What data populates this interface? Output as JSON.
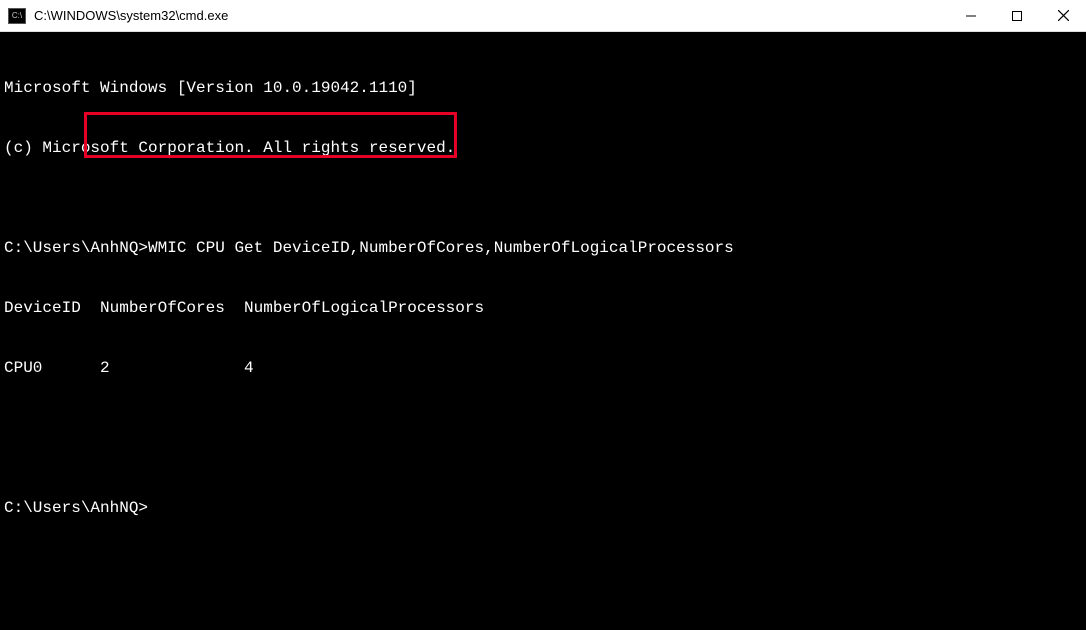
{
  "titlebar": {
    "icon_label": "C:\\",
    "title": "C:\\WINDOWS\\system32\\cmd.exe"
  },
  "terminal": {
    "line1": "Microsoft Windows [Version 10.0.19042.1110]",
    "line2": "(c) Microsoft Corporation. All rights reserved.",
    "blank1": "",
    "prompt1": "C:\\Users\\AnhNQ>",
    "command1": "WMIC CPU Get DeviceID,NumberOfCores,NumberOfLogicalProcessors",
    "header_deviceid": "DeviceID  ",
    "header_cores": "NumberOfCores  ",
    "header_logical": "NumberOfLogicalProcessors",
    "row_deviceid": "CPU0      ",
    "row_cores": "2              ",
    "row_logical": "4",
    "blank2": "",
    "blank3": "",
    "prompt2": "C:\\Users\\AnhNQ>"
  }
}
